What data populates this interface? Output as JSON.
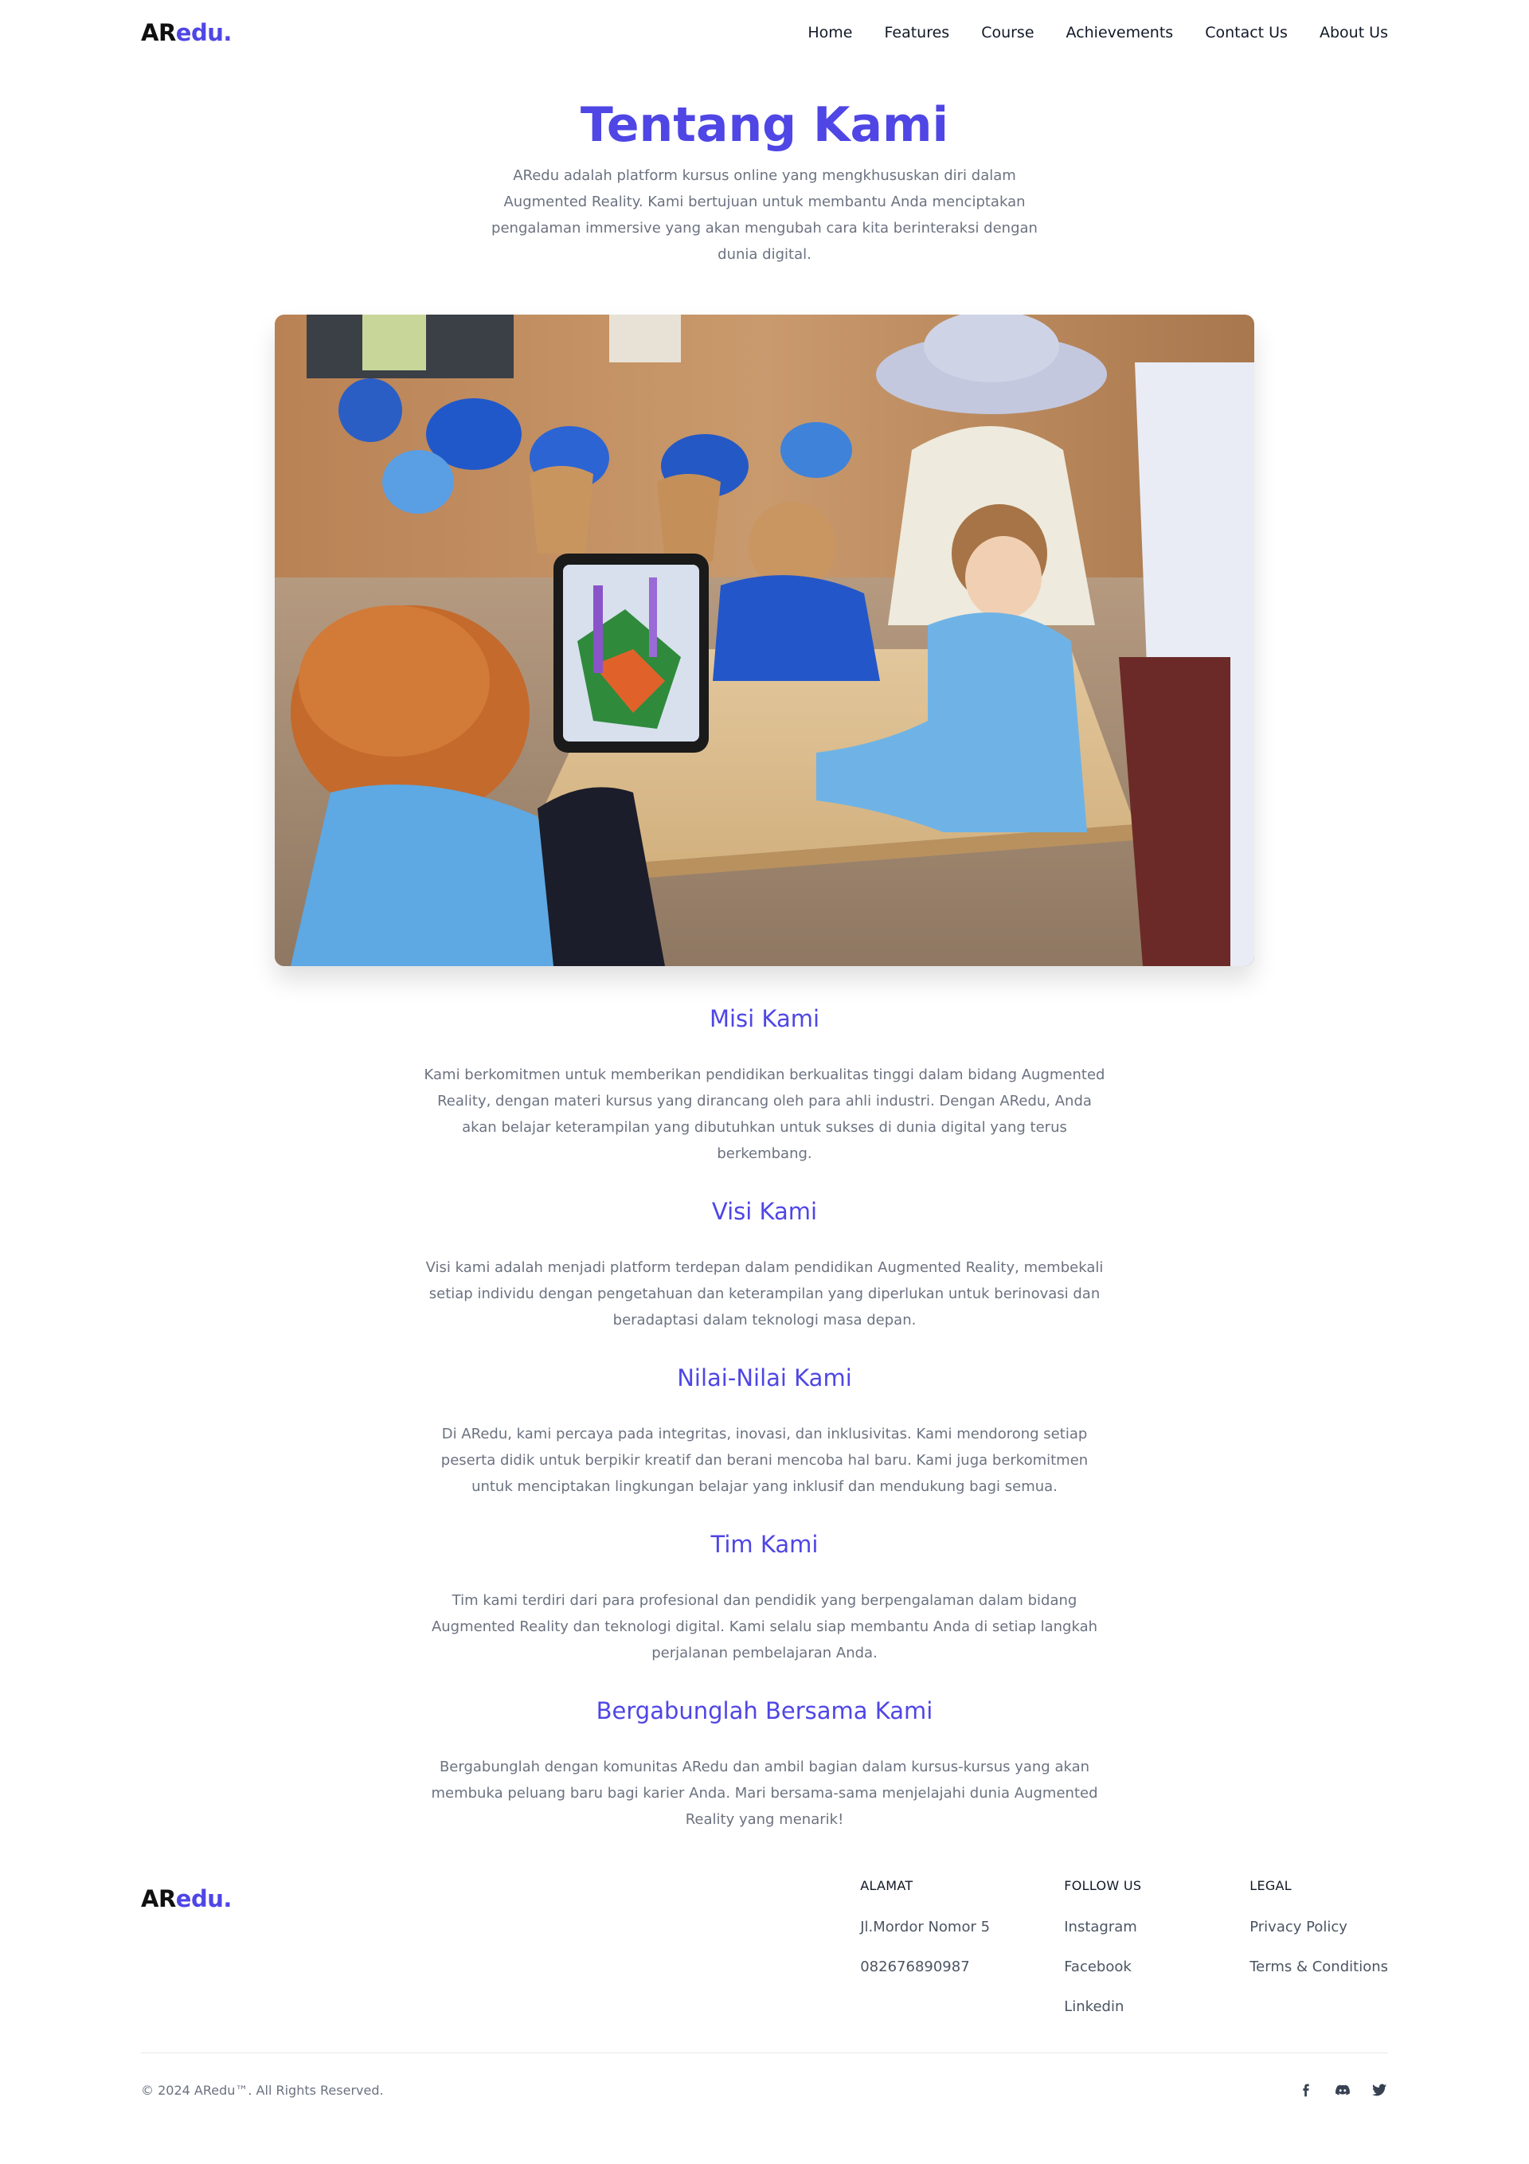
{
  "header": {
    "logo_ar": "AR",
    "logo_edu": "edu.",
    "nav": [
      "Home",
      "Features",
      "Course",
      "Achievements",
      "Contact Us",
      "About Us"
    ]
  },
  "hero": {
    "title": "Tentang Kami",
    "text": "ARedu adalah platform kursus online yang mengkhususkan diri dalam Augmented Reality. Kami bertujuan untuk membantu Anda menciptakan pengalaman immersive yang akan mengubah cara kita berinteraksi dengan dunia digital."
  },
  "sections": [
    {
      "title": "Misi Kami",
      "text": "Kami berkomitmen untuk memberikan pendidikan berkualitas tinggi dalam bidang Augmented Reality, dengan materi kursus yang dirancang oleh para ahli industri. Dengan ARedu, Anda akan belajar keterampilan yang dibutuhkan untuk sukses di dunia digital yang terus berkembang."
    },
    {
      "title": "Visi Kami",
      "text": "Visi kami adalah menjadi platform terdepan dalam pendidikan Augmented Reality, membekali setiap individu dengan pengetahuan dan keterampilan yang diperlukan untuk berinovasi dan beradaptasi dalam teknologi masa depan."
    },
    {
      "title": "Nilai-Nilai Kami",
      "text": "Di ARedu, kami percaya pada integritas, inovasi, dan inklusivitas. Kami mendorong setiap peserta didik untuk berpikir kreatif dan berani mencoba hal baru. Kami juga berkomitmen untuk menciptakan lingkungan belajar yang inklusif dan mendukung bagi semua."
    },
    {
      "title": "Tim Kami",
      "text": "Tim kami terdiri dari para profesional dan pendidik yang berpengalaman dalam bidang Augmented Reality dan teknologi digital. Kami selalu siap membantu Anda di setiap langkah perjalanan pembelajaran Anda."
    },
    {
      "title": "Bergabunglah Bersama Kami",
      "text": "Bergabunglah dengan komunitas ARedu dan ambil bagian dalam kursus-kursus yang akan membuka peluang baru bagi karier Anda. Mari bersama-sama menjelajahi dunia Augmented Reality yang menarik!"
    }
  ],
  "footer": {
    "logo_ar": "AR",
    "logo_edu": "edu.",
    "alamat": {
      "heading": "ALAMAT",
      "address": "Jl.Mordor Nomor 5",
      "phone": "082676890987"
    },
    "follow": {
      "heading": "FOLLOW US",
      "links": [
        "Instagram",
        "Facebook",
        "Linkedin"
      ]
    },
    "legal": {
      "heading": "LEGAL",
      "links": [
        "Privacy Policy",
        "Terms & Conditions"
      ]
    },
    "copyright": "© 2024 ARedu™. All Rights Reserved.",
    "social_icons": [
      "facebook-icon",
      "discord-icon",
      "twitter-icon"
    ]
  },
  "colors": {
    "accent": "#4f46e5",
    "text": "#111827",
    "muted": "#6b7280"
  }
}
